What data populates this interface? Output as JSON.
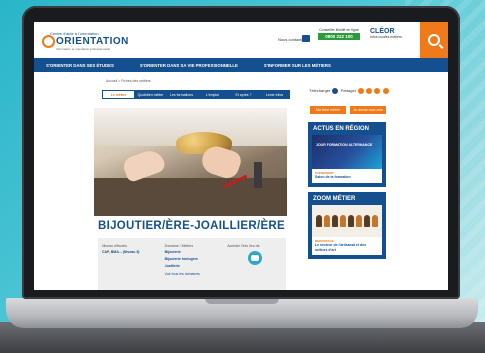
{
  "header": {
    "logo_top": "Centre d'aide à l'orientation",
    "logo_text": "ORIENTATION",
    "logo_sub": "Information et orientation professionnelle",
    "contact_label": "Nous contacter",
    "call_label": "Conseiller illimité en ligne",
    "call_number": "0800 222 100",
    "cleor_name": "CLÉOR",
    "cleor_sub": "Infos locales métiers"
  },
  "nav": {
    "items": [
      "S'ORIENTER DANS SES ÉTUDES",
      "S'ORIENTER DANS SA VIE PROFESSIONNELLE",
      "S'INFORMER SUR LES MÉTIERS"
    ]
  },
  "breadcrumb": "Accueil > Fiches des métiers",
  "tabs": [
    "Le métier",
    "Quotidien métier",
    "Les formations",
    "L'emploi",
    "Et après ?",
    "Lever infos"
  ],
  "job_title": "BIJOUTIER/ÈRE-JOAILLIER/ÈRE",
  "info": {
    "col1_head": "Niveau d'études",
    "col1_val": "CAP, BMA... (Niveau 3)",
    "col2_head": "Domaine / Métiers",
    "col2_vals": [
      "Bijouterie",
      "Bijouterie horlogère",
      "Joaillerie"
    ],
    "col2_link": "Voir tous les domaines",
    "col3_head": "Accéder l'info lieu de"
  },
  "sidebar": {
    "share_labels": [
      "Télécharger",
      "Partager"
    ],
    "btn_left": "Ma fiche métier",
    "btn_right": "Je donne mon avis",
    "actu_heading": "ACTUS EN RÉGION",
    "actu_img_text": "JOUR FORMATION ALTERNANCE",
    "actu_kicker": "ÉVÈNEMENT",
    "actu_text": "Salon de la formation",
    "zoom_heading": "ZOOM MÉTIER",
    "zoom_kicker": "REPORTAGE",
    "zoom_text": "Le secteur de l'artisanat et des métiers d'art"
  },
  "colors": {
    "brand_blue": "#14508f",
    "accent_orange": "#f07a1a",
    "call_green": "#2c9b3c"
  }
}
